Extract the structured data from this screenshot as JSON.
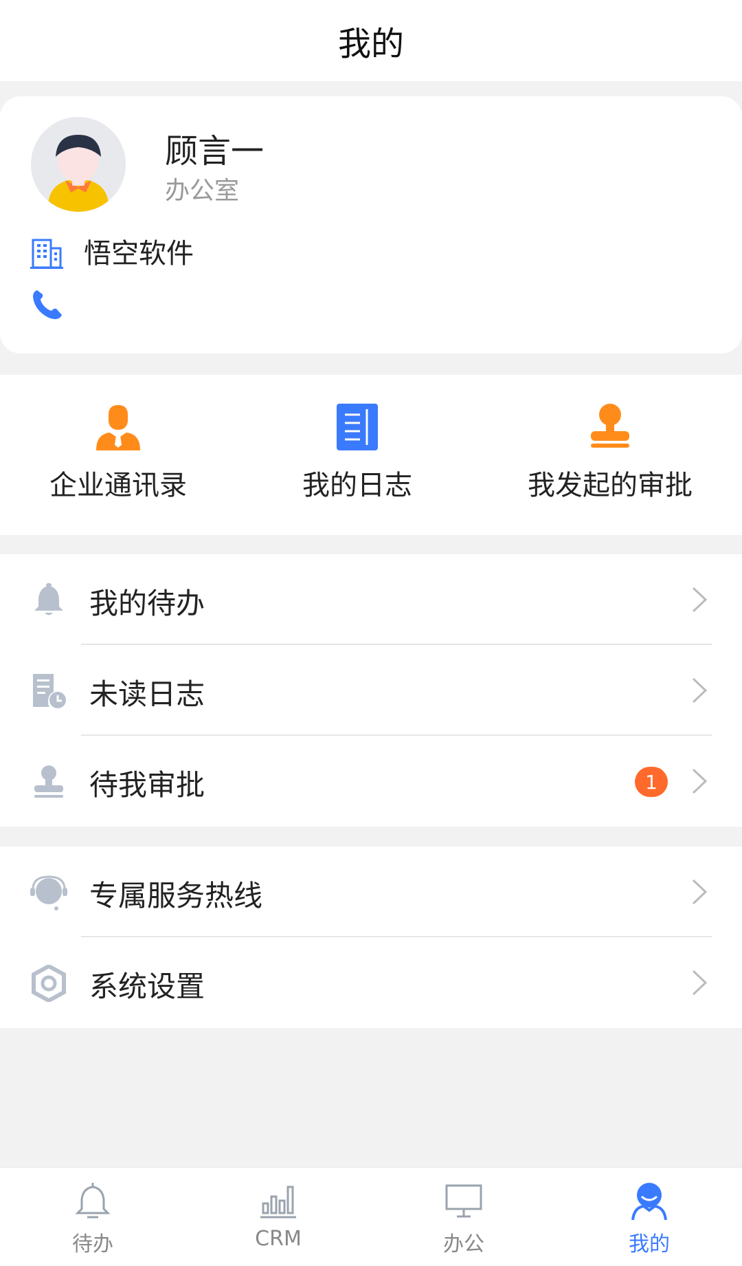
{
  "header": {
    "title": "我的"
  },
  "profile": {
    "name": "顾言一",
    "department": "办公室",
    "company": "悟空软件"
  },
  "shortcuts": [
    {
      "label": "企业通讯录",
      "icon": "contacts-icon"
    },
    {
      "label": "我的日志",
      "icon": "journal-icon"
    },
    {
      "label": "我发起的审批",
      "icon": "approval-stamp-icon"
    }
  ],
  "menu_group_1": [
    {
      "label": "我的待办",
      "icon": "bell-icon"
    },
    {
      "label": "未读日志",
      "icon": "unread-log-icon"
    },
    {
      "label": "待我审批",
      "icon": "stamp-icon",
      "badge": "1"
    }
  ],
  "menu_group_2": [
    {
      "label": "专属服务热线",
      "icon": "headset-icon"
    },
    {
      "label": "系统设置",
      "icon": "settings-hex-icon"
    }
  ],
  "tabbar": [
    {
      "label": "待办",
      "icon": "bell-icon",
      "active": false
    },
    {
      "label": "CRM",
      "icon": "bar-chart-icon",
      "active": false
    },
    {
      "label": "办公",
      "icon": "monitor-icon",
      "active": false
    },
    {
      "label": "我的",
      "icon": "user-icon",
      "active": true
    }
  ],
  "colors": {
    "accent": "#3a7afe",
    "orange": "#ff8c1a",
    "badge": "#ff6a2c",
    "muted_icon": "#b7c0cc"
  }
}
